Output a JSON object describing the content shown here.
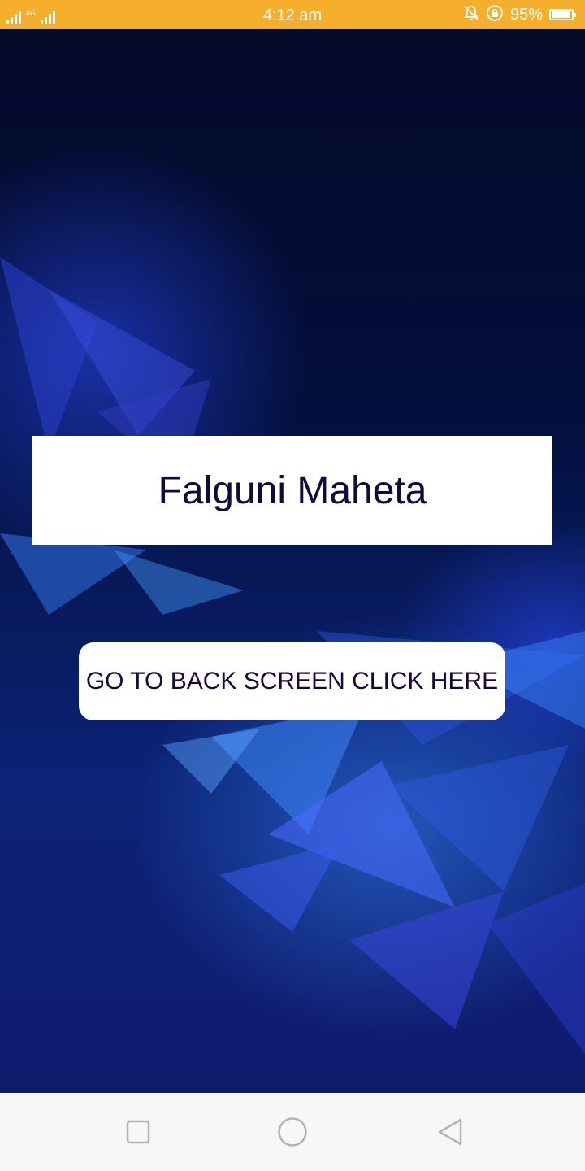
{
  "status_bar": {
    "network_label": "4G",
    "time": "4:12 am",
    "battery_percent": "95%",
    "battery_level": 0.95,
    "background_color": "#f6ae2d",
    "icons": [
      "signal-icon",
      "signal-icon",
      "mute-bell-icon",
      "rotation-lock-icon",
      "battery-icon"
    ]
  },
  "main": {
    "name_text": "Falguni Maheta",
    "button_label": "GO TO BACK SCREEN CLICK HERE",
    "text_color": "#14083f"
  },
  "nav_bar": {
    "icons": [
      "recent-apps-icon",
      "home-icon",
      "back-icon"
    ]
  }
}
